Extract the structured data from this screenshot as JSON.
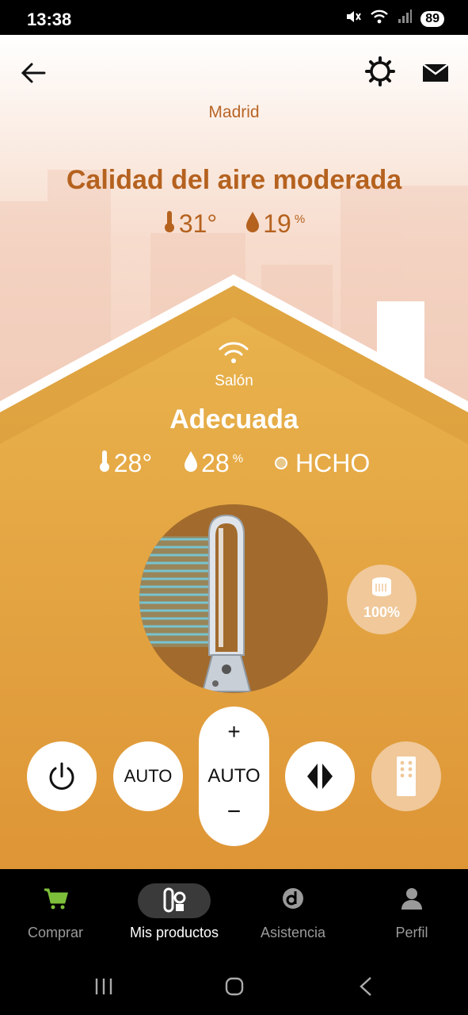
{
  "status_bar": {
    "time": "13:38",
    "battery": "89",
    "icons": [
      "mute-icon",
      "wifi-icon",
      "signal-icon"
    ]
  },
  "header": {
    "back_icon": "arrow-left-icon",
    "settings_icon": "gear-icon",
    "mail_icon": "mail-icon"
  },
  "outdoor": {
    "city": "Madrid",
    "quality": "Calidad del aire moderada",
    "temperature": "31°",
    "humidity": "19",
    "humidity_unit": "%"
  },
  "indoor": {
    "room": "Salón",
    "quality": "Adecuada",
    "temperature": "28°",
    "humidity": "28",
    "humidity_unit": "%",
    "pollutant": "HCHO"
  },
  "filter": {
    "level": "100%",
    "level_value": 1.0
  },
  "controls": {
    "auto_label": "AUTO",
    "speed_plus": "+",
    "speed_label": "AUTO",
    "speed_minus": "−"
  },
  "bottom_nav": {
    "items": [
      {
        "label": "Comprar",
        "icon": "cart-icon",
        "active": false
      },
      {
        "label": "Mis productos",
        "icon": "products-icon",
        "active": true
      },
      {
        "label": "Asistencia",
        "icon": "support-icon",
        "active": false
      },
      {
        "label": "Perfil",
        "icon": "person-icon",
        "active": false
      }
    ]
  },
  "colors": {
    "brand_orange": "#b5621f",
    "house_orange": "#e3a548",
    "cart_green": "#7dbf3a"
  }
}
